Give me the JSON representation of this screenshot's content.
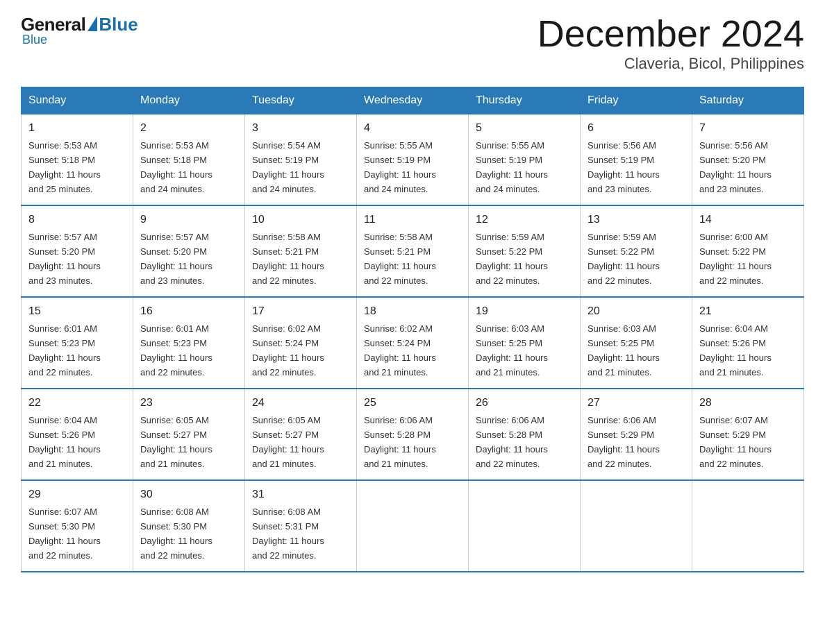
{
  "logo": {
    "general": "General",
    "blue": "Blue"
  },
  "header": {
    "month": "December 2024",
    "location": "Claveria, Bicol, Philippines"
  },
  "weekdays": [
    "Sunday",
    "Monday",
    "Tuesday",
    "Wednesday",
    "Thursday",
    "Friday",
    "Saturday"
  ],
  "weeks": [
    [
      {
        "day": "1",
        "sunrise": "5:53 AM",
        "sunset": "5:18 PM",
        "daylight": "11 hours and 25 minutes."
      },
      {
        "day": "2",
        "sunrise": "5:53 AM",
        "sunset": "5:18 PM",
        "daylight": "11 hours and 24 minutes."
      },
      {
        "day": "3",
        "sunrise": "5:54 AM",
        "sunset": "5:19 PM",
        "daylight": "11 hours and 24 minutes."
      },
      {
        "day": "4",
        "sunrise": "5:55 AM",
        "sunset": "5:19 PM",
        "daylight": "11 hours and 24 minutes."
      },
      {
        "day": "5",
        "sunrise": "5:55 AM",
        "sunset": "5:19 PM",
        "daylight": "11 hours and 24 minutes."
      },
      {
        "day": "6",
        "sunrise": "5:56 AM",
        "sunset": "5:19 PM",
        "daylight": "11 hours and 23 minutes."
      },
      {
        "day": "7",
        "sunrise": "5:56 AM",
        "sunset": "5:20 PM",
        "daylight": "11 hours and 23 minutes."
      }
    ],
    [
      {
        "day": "8",
        "sunrise": "5:57 AM",
        "sunset": "5:20 PM",
        "daylight": "11 hours and 23 minutes."
      },
      {
        "day": "9",
        "sunrise": "5:57 AM",
        "sunset": "5:20 PM",
        "daylight": "11 hours and 23 minutes."
      },
      {
        "day": "10",
        "sunrise": "5:58 AM",
        "sunset": "5:21 PM",
        "daylight": "11 hours and 22 minutes."
      },
      {
        "day": "11",
        "sunrise": "5:58 AM",
        "sunset": "5:21 PM",
        "daylight": "11 hours and 22 minutes."
      },
      {
        "day": "12",
        "sunrise": "5:59 AM",
        "sunset": "5:22 PM",
        "daylight": "11 hours and 22 minutes."
      },
      {
        "day": "13",
        "sunrise": "5:59 AM",
        "sunset": "5:22 PM",
        "daylight": "11 hours and 22 minutes."
      },
      {
        "day": "14",
        "sunrise": "6:00 AM",
        "sunset": "5:22 PM",
        "daylight": "11 hours and 22 minutes."
      }
    ],
    [
      {
        "day": "15",
        "sunrise": "6:01 AM",
        "sunset": "5:23 PM",
        "daylight": "11 hours and 22 minutes."
      },
      {
        "day": "16",
        "sunrise": "6:01 AM",
        "sunset": "5:23 PM",
        "daylight": "11 hours and 22 minutes."
      },
      {
        "day": "17",
        "sunrise": "6:02 AM",
        "sunset": "5:24 PM",
        "daylight": "11 hours and 22 minutes."
      },
      {
        "day": "18",
        "sunrise": "6:02 AM",
        "sunset": "5:24 PM",
        "daylight": "11 hours and 21 minutes."
      },
      {
        "day": "19",
        "sunrise": "6:03 AM",
        "sunset": "5:25 PM",
        "daylight": "11 hours and 21 minutes."
      },
      {
        "day": "20",
        "sunrise": "6:03 AM",
        "sunset": "5:25 PM",
        "daylight": "11 hours and 21 minutes."
      },
      {
        "day": "21",
        "sunrise": "6:04 AM",
        "sunset": "5:26 PM",
        "daylight": "11 hours and 21 minutes."
      }
    ],
    [
      {
        "day": "22",
        "sunrise": "6:04 AM",
        "sunset": "5:26 PM",
        "daylight": "11 hours and 21 minutes."
      },
      {
        "day": "23",
        "sunrise": "6:05 AM",
        "sunset": "5:27 PM",
        "daylight": "11 hours and 21 minutes."
      },
      {
        "day": "24",
        "sunrise": "6:05 AM",
        "sunset": "5:27 PM",
        "daylight": "11 hours and 21 minutes."
      },
      {
        "day": "25",
        "sunrise": "6:06 AM",
        "sunset": "5:28 PM",
        "daylight": "11 hours and 21 minutes."
      },
      {
        "day": "26",
        "sunrise": "6:06 AM",
        "sunset": "5:28 PM",
        "daylight": "11 hours and 22 minutes."
      },
      {
        "day": "27",
        "sunrise": "6:06 AM",
        "sunset": "5:29 PM",
        "daylight": "11 hours and 22 minutes."
      },
      {
        "day": "28",
        "sunrise": "6:07 AM",
        "sunset": "5:29 PM",
        "daylight": "11 hours and 22 minutes."
      }
    ],
    [
      {
        "day": "29",
        "sunrise": "6:07 AM",
        "sunset": "5:30 PM",
        "daylight": "11 hours and 22 minutes."
      },
      {
        "day": "30",
        "sunrise": "6:08 AM",
        "sunset": "5:30 PM",
        "daylight": "11 hours and 22 minutes."
      },
      {
        "day": "31",
        "sunrise": "6:08 AM",
        "sunset": "5:31 PM",
        "daylight": "11 hours and 22 minutes."
      },
      null,
      null,
      null,
      null
    ]
  ],
  "labels": {
    "sunrise": "Sunrise:",
    "sunset": "Sunset:",
    "daylight": "Daylight:"
  }
}
